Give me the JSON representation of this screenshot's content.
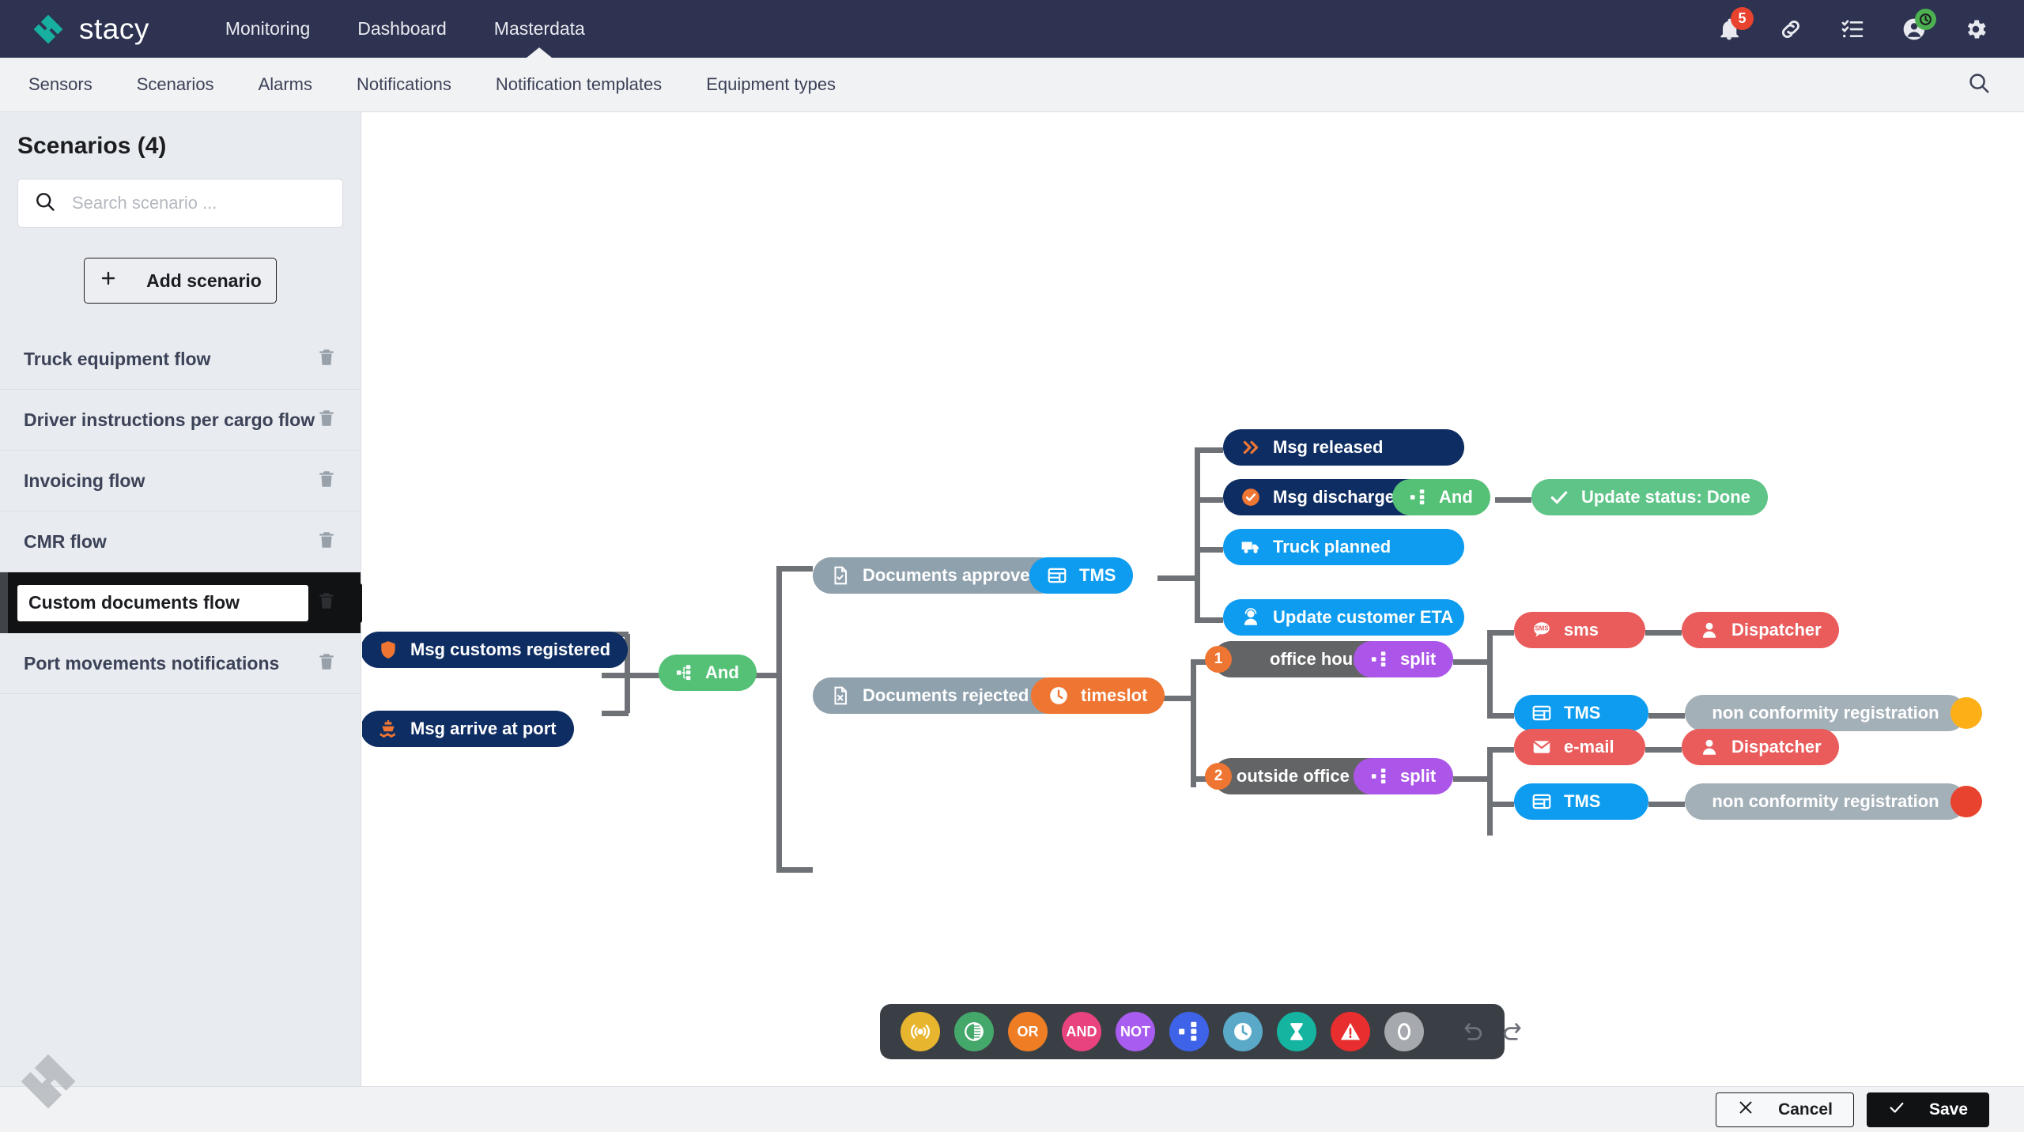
{
  "header": {
    "brand": "stacy",
    "brand_color": "#17b0a0",
    "bg_color": "#2d3350",
    "nav": [
      {
        "label": "Monitoring",
        "active": false
      },
      {
        "label": "Dashboard",
        "active": false
      },
      {
        "label": "Masterdata",
        "active": true
      }
    ],
    "icons": [
      {
        "name": "bell-icon",
        "badge": "5",
        "badge_color": "#e8432f"
      },
      {
        "name": "link-icon",
        "badge": null
      },
      {
        "name": "checklist-icon",
        "badge": null
      },
      {
        "name": "user-icon",
        "badge": "clock",
        "badge_color": "#4caf50"
      },
      {
        "name": "gear-icon",
        "badge": null
      }
    ]
  },
  "subnav": {
    "items": [
      {
        "label": "Sensors"
      },
      {
        "label": "Scenarios"
      },
      {
        "label": "Alarms"
      },
      {
        "label": "Notifications"
      },
      {
        "label": "Notification templates"
      },
      {
        "label": "Equipment types"
      }
    ],
    "search_icon": "search-icon"
  },
  "sidebar": {
    "title": "Scenarios (4)",
    "search": {
      "placeholder": "Search scenario ...",
      "value": ""
    },
    "add_button": {
      "label": "Add scenario",
      "icon": "plus-icon"
    },
    "scenarios": [
      {
        "label": "Truck equipment flow",
        "selected": false
      },
      {
        "label": "Driver instructions per cargo flow",
        "selected": false
      },
      {
        "label": "Invoicing flow",
        "selected": false
      },
      {
        "label": "CMR flow",
        "selected": false
      },
      {
        "label": "Custom documents flow",
        "selected": true
      },
      {
        "label": "Port movements notifications",
        "selected": false
      }
    ]
  },
  "flow": {
    "nodes": [
      {
        "id": "msg-customs-registered",
        "label": "Msg customs registered",
        "icon": "shield-icon",
        "color": "#0e2d63",
        "icon_color": "#ef7632"
      },
      {
        "id": "msg-arrive-at-port",
        "label": "Msg arrive at port",
        "icon": "ship-icon",
        "color": "#0e2d63",
        "icon_color": "#ef7632"
      },
      {
        "id": "and-1",
        "label": "And",
        "icon": "split-icon",
        "color": "#55c177"
      },
      {
        "id": "documents-approved",
        "label": "Documents approved",
        "icon": "doc-check-icon",
        "color": "#8fa1ad"
      },
      {
        "id": "tms-1",
        "label": "TMS",
        "icon": "tms-icon",
        "color": "#0d9cf0"
      },
      {
        "id": "msg-released",
        "label": "Msg released",
        "icon": "chevrons-icon",
        "color": "#0e2d63",
        "icon_color": "#ef7632"
      },
      {
        "id": "msg-discharged",
        "label": "Msg discharged",
        "icon": "check-circle-icon",
        "color": "#0e2d63",
        "icon_color": "#ef7632"
      },
      {
        "id": "truck-planned",
        "label": "Truck planned",
        "icon": "truck-icon",
        "color": "#0d9cf0"
      },
      {
        "id": "update-customer-eta",
        "label": "Update customer ETA",
        "icon": "headset-icon",
        "color": "#0d9cf0"
      },
      {
        "id": "and-2",
        "label": "And",
        "icon": "split-icon",
        "color": "#55c177"
      },
      {
        "id": "update-status-done",
        "label": "Update status: Done",
        "icon": "check-icon",
        "color": "#5ec487"
      },
      {
        "id": "documents-rejected",
        "label": "Documents rejected :(",
        "icon": "doc-x-icon",
        "color": "#8fa1ad"
      },
      {
        "id": "timeslot",
        "label": "timeslot",
        "icon": "clock-icon",
        "color": "#ef7632"
      },
      {
        "id": "office-hours",
        "label": "office hours",
        "badge": "1",
        "color": "#636466"
      },
      {
        "id": "split-1",
        "label": "split",
        "icon": "split-icon",
        "color": "#ab56e8"
      },
      {
        "id": "sms",
        "label": "sms",
        "icon": "sms-icon",
        "color": "#ea5b5b"
      },
      {
        "id": "dispatcher-1",
        "label": "Dispatcher",
        "icon": "person-icon",
        "color": "#ea5b5b"
      },
      {
        "id": "tms-2",
        "label": "TMS",
        "icon": "tms-icon",
        "color": "#0d9cf0"
      },
      {
        "id": "non-conformity-1",
        "label": "non conformity registration",
        "color": "#a4b0b8",
        "end_dot": "#fcaf17"
      },
      {
        "id": "outside-office-hours",
        "label": "outside office hours",
        "badge": "2",
        "color": "#636466"
      },
      {
        "id": "split-2",
        "label": "split",
        "icon": "split-icon",
        "color": "#ab56e8"
      },
      {
        "id": "email",
        "label": "e-mail",
        "icon": "mail-icon",
        "color": "#ea5b5b"
      },
      {
        "id": "dispatcher-2",
        "label": "Dispatcher",
        "icon": "person-icon",
        "color": "#ea5b5b"
      },
      {
        "id": "tms-3",
        "label": "TMS",
        "icon": "tms-icon",
        "color": "#0d9cf0"
      },
      {
        "id": "non-conformity-2",
        "label": "non conformity registration",
        "color": "#a4b0b8",
        "end_dot": "#e8432f"
      }
    ]
  },
  "palette": {
    "tools": [
      {
        "name": "sensor-icon",
        "label": "",
        "color": "#e8b52e"
      },
      {
        "name": "threshold-icon",
        "label": "",
        "color": "#44a86b"
      },
      {
        "name": "or-icon",
        "label": "OR",
        "color": "#ef7d24"
      },
      {
        "name": "and-icon",
        "label": "AND",
        "color": "#e8437e"
      },
      {
        "name": "not-icon",
        "label": "NOT",
        "color": "#a95cf0"
      },
      {
        "name": "split-icon",
        "label": "",
        "color": "#3f63e8"
      },
      {
        "name": "clock-icon",
        "label": "",
        "color": "#5aa9c9"
      },
      {
        "name": "hourglass-icon",
        "label": "",
        "color": "#14b4a0"
      },
      {
        "name": "warning-icon",
        "label": "",
        "color": "#e82e2e"
      },
      {
        "name": "circle-icon",
        "label": "",
        "color": "#a6aaae"
      }
    ],
    "undo": "undo-icon",
    "redo": "redo-icon"
  },
  "footer": {
    "cancel": {
      "label": "Cancel",
      "icon": "close-icon"
    },
    "save": {
      "label": "Save",
      "icon": "check-icon"
    }
  }
}
